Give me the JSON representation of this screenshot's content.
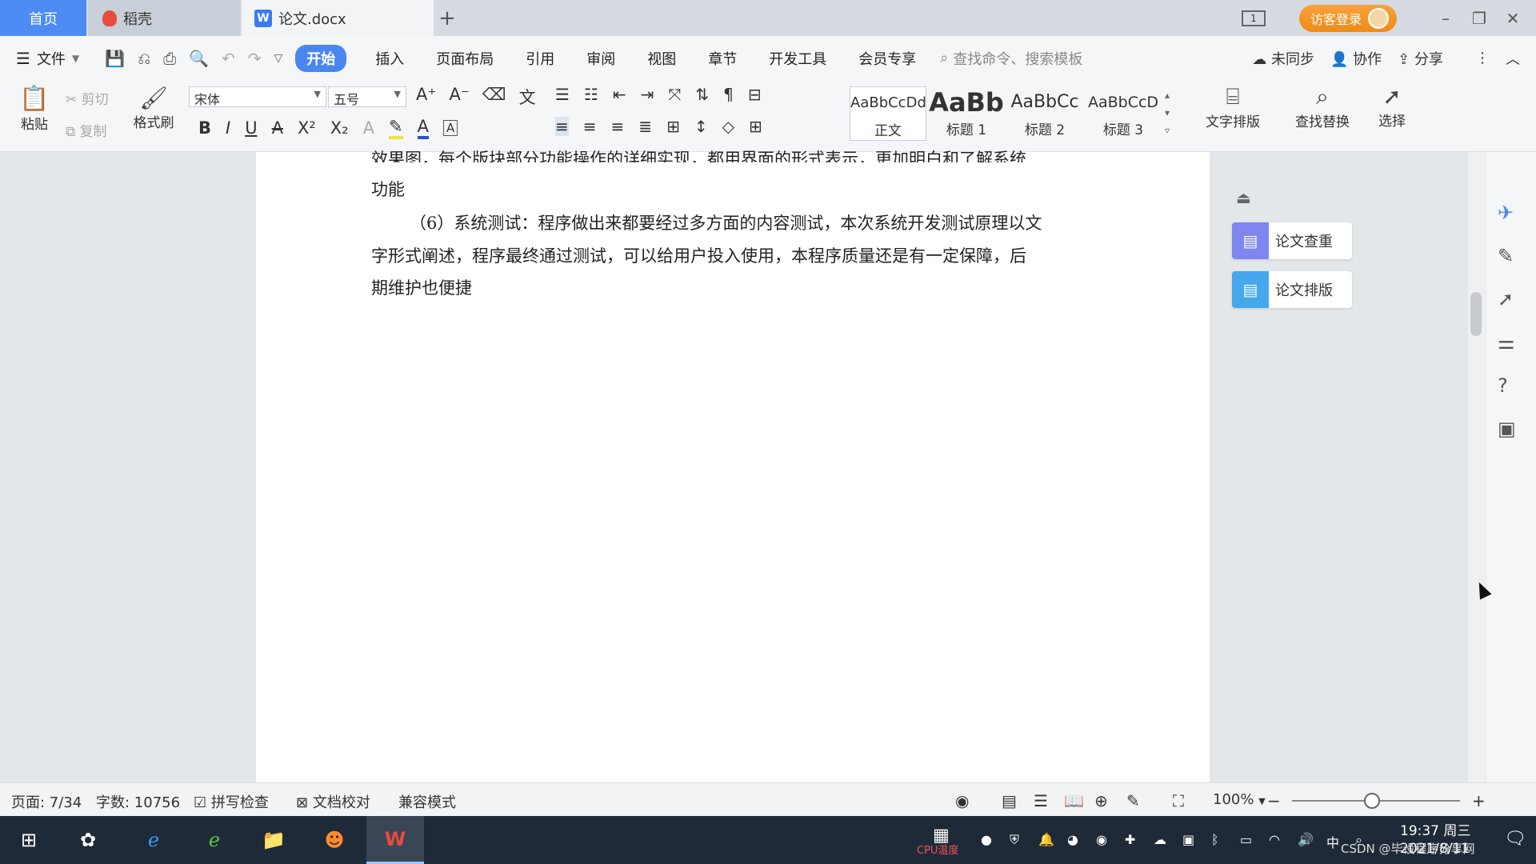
{
  "titlebar": {
    "tab_home": "首页",
    "tab_daoke": "稻壳",
    "tab_doc": "论文.docx",
    "tab_add": "+",
    "page_indicator": "1",
    "login_label": "访客登录",
    "min": "–",
    "restore": "❐",
    "close": "✕"
  },
  "menu": {
    "file": "文件",
    "tabs": [
      "开始",
      "插入",
      "页面布局",
      "引用",
      "审阅",
      "视图",
      "章节",
      "开发工具",
      "会员专享"
    ],
    "search_placeholder": "查找命令、搜索模板",
    "sync": "未同步",
    "collab": "协作",
    "share": "分享"
  },
  "ribbon": {
    "paste": "粘贴",
    "cut": "剪切",
    "copy": "复制",
    "format_painter": "格式刷",
    "font_name": "宋体",
    "font_size": "五号",
    "styles": [
      {
        "sample": "AaBbCcDd",
        "label": "正文"
      },
      {
        "sample": "AaBb",
        "label": "标题 1"
      },
      {
        "sample": "AaBbCc",
        "label": "标题 2"
      },
      {
        "sample": "AaBbCcD",
        "label": "标题 3"
      }
    ],
    "text_layout": "文字排版",
    "find_replace": "查找替换",
    "select": "选择"
  },
  "document": {
    "line_top": "效果图，每个版块部分功能操作的详细实现，都用界面的形式表示，更加明白和了解系统",
    "line_func": "功能",
    "para6_line1": "（6）系统测试：程序做出来都要经过多方面的内容测试，本次系统开发测试原理以文",
    "para6_line2": "字形式阐述，程序最终通过测试，可以给用户投入使用，本程序质量还是有一定保障，后",
    "para6_line3": "期维护也便捷"
  },
  "side_panel": {
    "check": "论文查重",
    "layout": "论文排版"
  },
  "status": {
    "page": "页面: 7/34",
    "words": "字数: 10756",
    "spell": "拼写检查",
    "proof": "文档校对",
    "compat": "兼容模式",
    "zoom": "100%"
  },
  "taskbar": {
    "time": "19:37 周三",
    "date": "2021/8/11",
    "ime": "中",
    "cpu": "CPU温度",
    "watermark": "CSDN @毕设程序分享网"
  },
  "colors": {
    "accent": "#4a86f0",
    "login": "#f0921f",
    "taskbar": "#1f2a38"
  }
}
